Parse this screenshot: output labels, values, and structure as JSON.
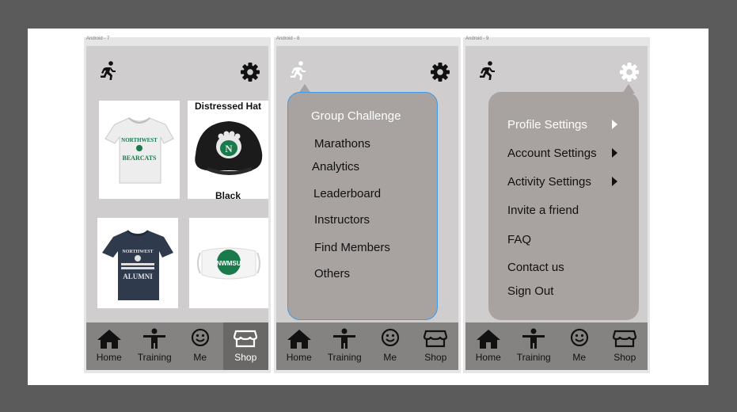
{
  "frames": [
    {
      "label": "Android - 7"
    },
    {
      "label": "Android - 8"
    },
    {
      "label": "Android - 9"
    }
  ],
  "shop": {
    "hat_title": "Distressed Hat",
    "hat_color": "Black",
    "shirt1_text": [
      "NORTHWEST",
      "BEARCATS"
    ],
    "shirt2_text": [
      "NORTHWEST",
      "ALUMNI"
    ],
    "mask_text": "NWMSU"
  },
  "nav": {
    "items": [
      {
        "label": "Home",
        "icon": "home-icon"
      },
      {
        "label": "Training",
        "icon": "person-arms-out-icon"
      },
      {
        "label": "Me",
        "icon": "smiley-icon"
      },
      {
        "label": "Shop",
        "icon": "storefront-icon"
      }
    ]
  },
  "training_menu": {
    "items": [
      "Group Challenge",
      "Marathons",
      "Analytics",
      "Leaderboard",
      "Instructors",
      "Find Members",
      "Others"
    ]
  },
  "settings_menu": {
    "items": [
      "Profile Settings",
      "Account Settings",
      "Activity Settings",
      "Invite a friend",
      "FAQ",
      "Contact us",
      "Sign Out"
    ]
  },
  "colors": {
    "background": "#5b5b5b",
    "screen": "#cfcdcd",
    "nav_bar": "#858282",
    "nav_active": "#6a6767",
    "menu": "#a8a2a0",
    "menu_border_highlight": "#3d9bea",
    "green": "#1a7a4c"
  }
}
